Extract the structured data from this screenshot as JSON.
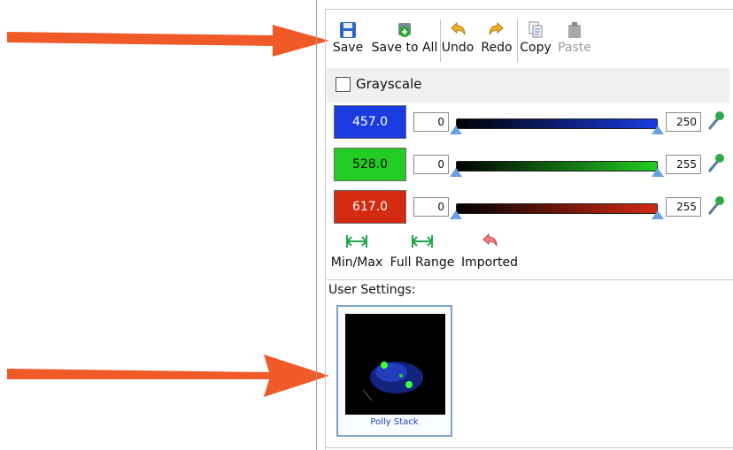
{
  "toolbar": {
    "save_label": "Save",
    "save_all_label": "Save to All",
    "undo_label": "Undo",
    "redo_label": "Redo",
    "copy_label": "Copy",
    "paste_label": "Paste"
  },
  "grayscale": {
    "label": "Grayscale",
    "checked": false
  },
  "channels": [
    {
      "wavelength": "457.0",
      "min": "0",
      "max": "250",
      "color": "#1a3be0"
    },
    {
      "wavelength": "528.0",
      "min": "0",
      "max": "255",
      "color": "#22cc22"
    },
    {
      "wavelength": "617.0",
      "min": "0",
      "max": "255",
      "color": "#d42a12"
    }
  ],
  "presets": [
    {
      "label": "Min/Max",
      "icon": "min-max-icon"
    },
    {
      "label": "Full Range",
      "icon": "full-range-icon"
    },
    {
      "label": "Imported",
      "icon": "undo-arrow-icon"
    }
  ],
  "user_settings": {
    "title": "User Settings:",
    "thumbnail_caption": "Polly Stack"
  },
  "annotation_color": "#f05a28"
}
